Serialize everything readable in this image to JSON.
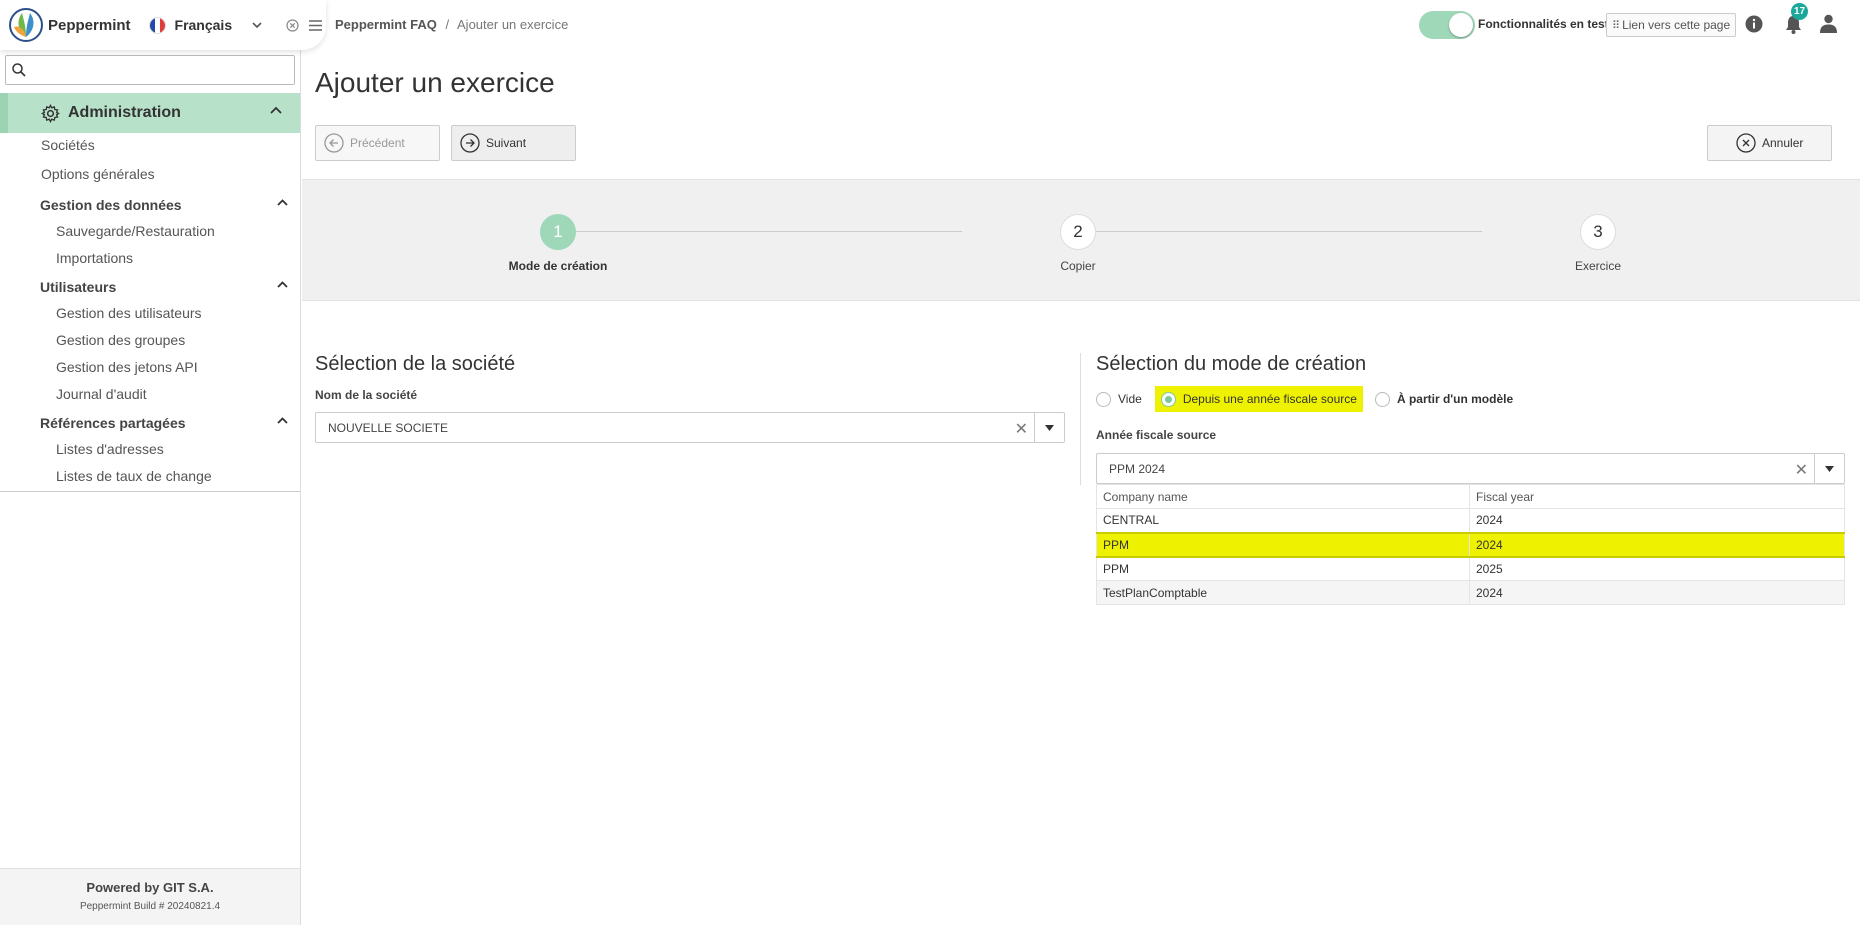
{
  "brand": {
    "app_name": "Peppermint",
    "language": "Français"
  },
  "sidebar": {
    "search_placeholder": "",
    "root": "Administration",
    "items": {
      "societes": "Sociétés",
      "options": "Options générales",
      "gestion_donnees": "Gestion des données",
      "sauvegarde": "Sauvegarde/Restauration",
      "importations": "Importations",
      "utilisateurs": "Utilisateurs",
      "gestion_utilisateurs": "Gestion des utilisateurs",
      "gestion_groupes": "Gestion des groupes",
      "gestion_jetons": "Gestion des jetons API",
      "journal_audit": "Journal d'audit",
      "references": "Références partagées",
      "listes_adresses": "Listes d'adresses",
      "listes_taux": "Listes de taux de change"
    },
    "footer": {
      "powered": "Powered by GIT S.A.",
      "build": "Peppermint Build # 20240821.4"
    }
  },
  "breadcrumb": {
    "root": "Peppermint FAQ",
    "separator": "/",
    "current": "Ajouter un exercice"
  },
  "topbar": {
    "features_label": "Fonctionnalités en test",
    "features_enabled": true,
    "link_label": "Lien vers cette page",
    "notifications_count": "17"
  },
  "page": {
    "title": "Ajouter un exercice",
    "prev_label": "Précédent",
    "next_label": "Suivant",
    "cancel_label": "Annuler"
  },
  "stepper": {
    "steps": [
      {
        "number": "1",
        "label": "Mode de création",
        "active": true
      },
      {
        "number": "2",
        "label": "Copier",
        "active": false
      },
      {
        "number": "3",
        "label": "Exercice",
        "active": false
      }
    ]
  },
  "company": {
    "section_title": "Sélection de la société",
    "field_label": "Nom de la société",
    "value": "NOUVELLE SOCIETE"
  },
  "mode": {
    "section_title": "Sélection du mode de création",
    "options": [
      {
        "label": "Vide",
        "selected": false
      },
      {
        "label": "Depuis une année fiscale source",
        "selected": true
      },
      {
        "label": "À partir d'un modèle",
        "selected": false
      }
    ],
    "source_label": "Année fiscale source",
    "source_value": "PPM 2024",
    "grid": {
      "headers": [
        "Company name",
        "Fiscal year"
      ],
      "rows": [
        [
          "CENTRAL",
          "2024"
        ],
        [
          "PPM",
          "2024"
        ],
        [
          "PPM",
          "2025"
        ],
        [
          "TestPlanComptable",
          "2024"
        ]
      ],
      "selected_row": 1
    }
  },
  "colors": {
    "accent": "#9fd8b9",
    "highlight": "#eef200",
    "badge": "#1aa89a"
  }
}
